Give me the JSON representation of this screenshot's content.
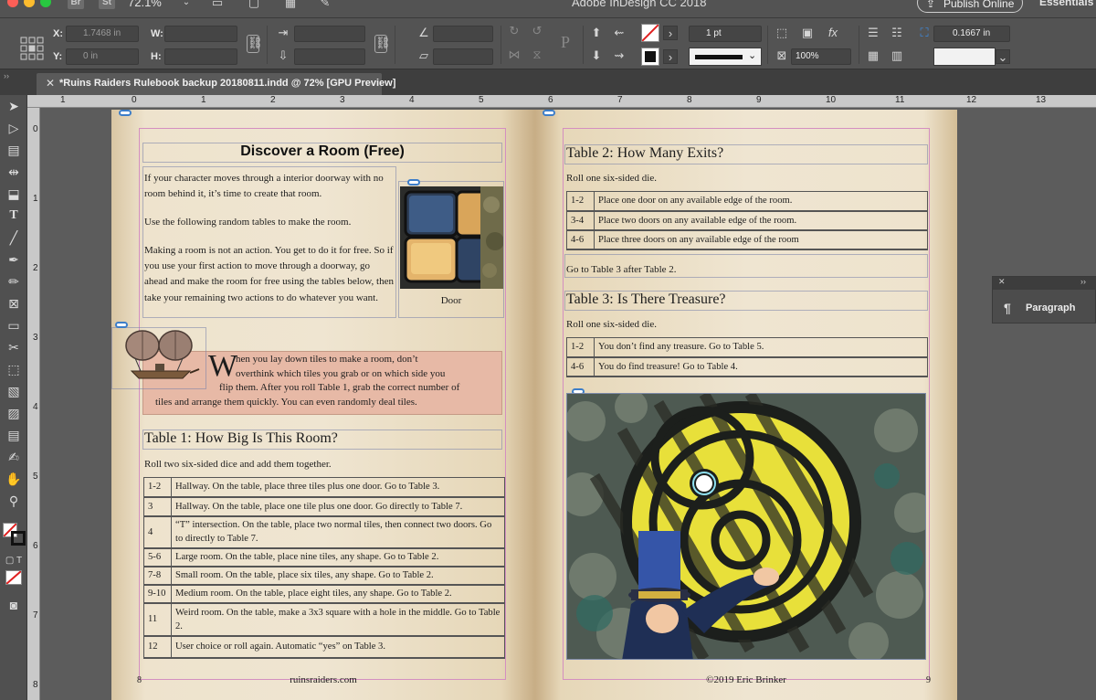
{
  "titlebar": {
    "bridge_label": "Br",
    "stock_label": "St",
    "zoom": "72.1%",
    "app_title": "Adobe InDesign CC 2018",
    "publish_label": "Publish Online",
    "workspace": "Essentials"
  },
  "controlbar": {
    "x_label": "X:",
    "x_value": "1.7468 in",
    "y_label": "Y:",
    "y_value": "0 in",
    "w_label": "W:",
    "h_label": "H:",
    "stroke_weight": "1 pt",
    "opacity": "100%",
    "gap_value": "0.1667 in"
  },
  "tab": {
    "title": "*Ruins Raiders Rulebook backup 20180811.indd @ 72% [GPU Preview]"
  },
  "ruler": {
    "top_numbers": [
      "1",
      "0",
      "1",
      "2",
      "3",
      "4",
      "5",
      "6",
      "7",
      "8",
      "9",
      "10",
      "11",
      "12",
      "13"
    ],
    "left_numbers": [
      "0",
      "1",
      "2",
      "3",
      "4",
      "5",
      "6",
      "7",
      "8"
    ]
  },
  "left_page": {
    "title": "Discover a Room (Free)",
    "intro_para1": "If your character moves through a interior doorway with no room behind it, it’s time to create that room.",
    "intro_para2": "Use the following random tables to make the room.",
    "intro_para3": "Making a room is not an action. You get to do it for free. So if you use your first action to move through a doorway, go ahead and make the room for free using the tables below, then take your remaining two actions to do whatever you want.",
    "door_caption": "Door",
    "tip_dropcap": "W",
    "tip_text_line1": "hen you lay down tiles to make a room, don’t",
    "tip_text_line2": "overthink which tiles you grab or on which side you",
    "tip_text_line3": "flip them. After you roll Table 1, grab the correct number of",
    "tip_text_line4": "tiles and arrange them quickly. You can even randomly deal tiles.",
    "table1_title": "Table 1: How Big Is This Room?",
    "table1_instruction": "Roll two six-sided dice and add them together.",
    "table1_rows": [
      {
        "roll": "1-2",
        "result": "Hallway. On the table, place three tiles plus one door. Go to Table 3."
      },
      {
        "roll": "3",
        "result": "Hallway. On the table, place one tile plus one door. Go directly to Table 7."
      },
      {
        "roll": "4",
        "result": "“T” intersection. On the table, place two normal tiles, then connect two doors. Go to directly to Table 7."
      },
      {
        "roll": "5-6",
        "result": "Large room. On the table, place nine tiles, any shape. Go to Table 2."
      },
      {
        "roll": "7-8",
        "result": "Small room. On the table, place six tiles, any shape. Go to Table 2."
      },
      {
        "roll": "9-10",
        "result": "Medium room. On the table, place eight tiles, any shape. Go to Table 2."
      },
      {
        "roll": "11",
        "result": "Weird room. On the table, make a 3x3 square with a hole in the middle. Go to Table 2."
      },
      {
        "roll": "12",
        "result": "User choice or roll again. Automatic “yes” on Table 3."
      }
    ],
    "page_number": "8",
    "footer": "ruinsraiders.com"
  },
  "right_page": {
    "table2_title": "Table 2: How Many Exits?",
    "table2_instruction": "Roll one six-sided die.",
    "table2_rows": [
      {
        "roll": "1-2",
        "result": "Place one door on any available edge of the room."
      },
      {
        "roll": "3-4",
        "result": "Place two doors on any available edge of the room."
      },
      {
        "roll": "4-6",
        "result": "Place three doors on any available edge of the room"
      }
    ],
    "table2_after": "Go to Table 3 after Table 2.",
    "table3_title": "Table 3: Is There Treasure?",
    "table3_instruction": "Roll one six-sided die.",
    "table3_rows": [
      {
        "roll": "1-2",
        "result": "You don’t find any treasure. Go to Table 5."
      },
      {
        "roll": "4-6",
        "result": "You do find treasure! Go to Table 4."
      }
    ],
    "footer": "©2019 Eric Brinker",
    "page_number": "9"
  },
  "panel": {
    "label": "Paragraph"
  }
}
